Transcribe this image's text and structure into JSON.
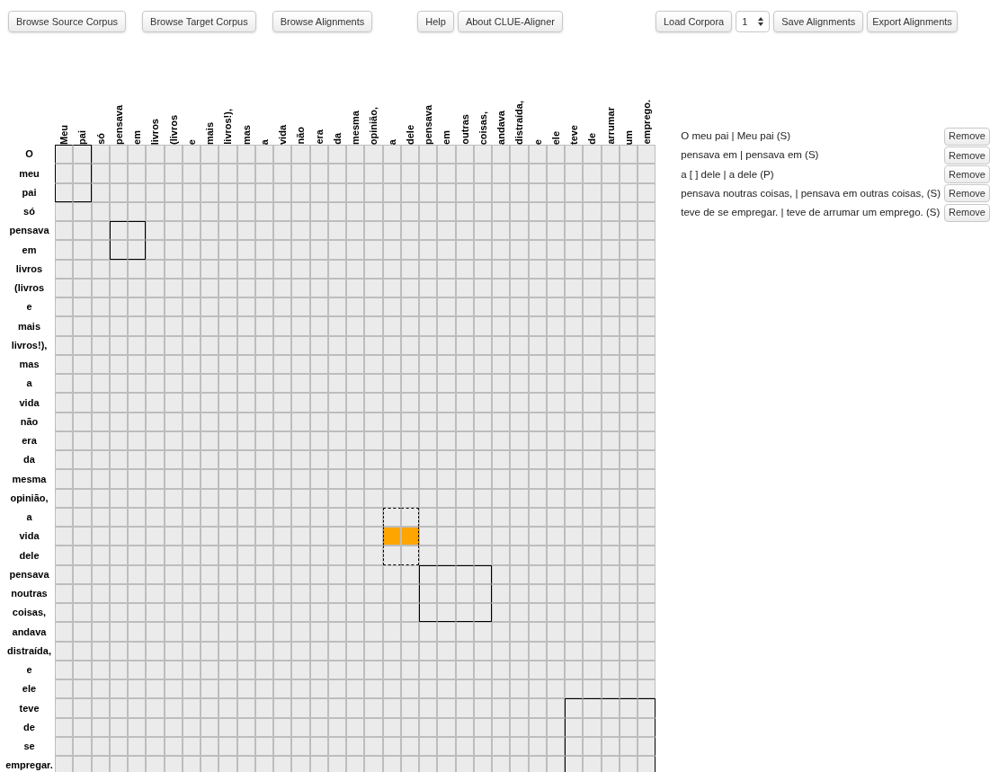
{
  "toolbar": {
    "left_buttons": [
      "Browse Source Corpus",
      "Browse Target Corpus",
      "Browse Alignments"
    ],
    "help_buttons": [
      "Help",
      "About CLUE-Aligner"
    ],
    "load_button": "Load Corpora",
    "corpus_select": {
      "value": "1"
    },
    "right_buttons": [
      "Save Alignments",
      "Export Alignments"
    ]
  },
  "matrix": {
    "target_words": [
      {
        "text": "Meu",
        "aligned": true,
        "block_start": true,
        "selected": false
      },
      {
        "text": "pai",
        "aligned": true,
        "block_start": false,
        "selected": false
      },
      {
        "text": "só",
        "aligned": false,
        "selected": false
      },
      {
        "text": "pensava",
        "aligned": true,
        "block_start": true,
        "selected": false
      },
      {
        "text": "em",
        "aligned": true,
        "block_start": false,
        "selected": false
      },
      {
        "text": "livros",
        "aligned": false,
        "selected": false
      },
      {
        "text": "(livros",
        "aligned": false,
        "selected": false
      },
      {
        "text": "e",
        "aligned": false,
        "selected": false
      },
      {
        "text": "mais",
        "aligned": false,
        "selected": false
      },
      {
        "text": "livros!),",
        "aligned": false,
        "selected": false
      },
      {
        "text": "mas",
        "aligned": false,
        "selected": false
      },
      {
        "text": "a",
        "aligned": false,
        "selected": false
      },
      {
        "text": "vida",
        "aligned": false,
        "selected": false
      },
      {
        "text": "não",
        "aligned": false,
        "selected": false
      },
      {
        "text": "era",
        "aligned": false,
        "selected": false
      },
      {
        "text": "da",
        "aligned": false,
        "selected": false
      },
      {
        "text": "mesma",
        "aligned": false,
        "selected": false
      },
      {
        "text": "opinião,",
        "aligned": false,
        "selected": false
      },
      {
        "text": "a",
        "aligned": true,
        "block_start": true,
        "selected": true
      },
      {
        "text": "dele",
        "aligned": true,
        "block_start": false,
        "selected": true
      },
      {
        "text": "pensava",
        "aligned": true,
        "block_start": true,
        "selected": false
      },
      {
        "text": "em",
        "aligned": true,
        "block_start": false,
        "selected": false
      },
      {
        "text": "outras",
        "aligned": true,
        "block_start": false,
        "selected": false
      },
      {
        "text": "coisas,",
        "aligned": true,
        "block_start": false,
        "selected": false
      },
      {
        "text": "andava",
        "aligned": false,
        "selected": false
      },
      {
        "text": "distraída,",
        "aligned": false,
        "selected": false
      },
      {
        "text": "e",
        "aligned": false,
        "selected": false
      },
      {
        "text": "ele",
        "aligned": false,
        "selected": false
      },
      {
        "text": "teve",
        "aligned": true,
        "block_start": true,
        "selected": false
      },
      {
        "text": "de",
        "aligned": true,
        "block_start": false,
        "selected": false
      },
      {
        "text": "arrumar",
        "aligned": true,
        "block_start": false,
        "selected": false
      },
      {
        "text": "um",
        "aligned": true,
        "block_start": false,
        "selected": false
      },
      {
        "text": "emprego.",
        "aligned": true,
        "block_start": false,
        "selected": false
      }
    ],
    "source_words": [
      {
        "text": "O",
        "aligned": true,
        "block_start": true,
        "selected": false
      },
      {
        "text": "meu",
        "aligned": true,
        "block_start": false,
        "selected": false
      },
      {
        "text": "pai",
        "aligned": true,
        "block_start": false,
        "selected": false
      },
      {
        "text": "só",
        "aligned": false,
        "selected": false
      },
      {
        "text": "pensava",
        "aligned": true,
        "block_start": true,
        "selected": false
      },
      {
        "text": "em",
        "aligned": true,
        "block_start": false,
        "selected": false
      },
      {
        "text": "livros",
        "aligned": false,
        "selected": false
      },
      {
        "text": "(livros",
        "aligned": false,
        "selected": false
      },
      {
        "text": "e",
        "aligned": false,
        "selected": false
      },
      {
        "text": "mais",
        "aligned": false,
        "selected": false
      },
      {
        "text": "livros!),",
        "aligned": false,
        "selected": false
      },
      {
        "text": "mas",
        "aligned": false,
        "selected": false
      },
      {
        "text": "a",
        "aligned": false,
        "selected": false
      },
      {
        "text": "vida",
        "aligned": false,
        "selected": false
      },
      {
        "text": "não",
        "aligned": false,
        "selected": false
      },
      {
        "text": "era",
        "aligned": false,
        "selected": false
      },
      {
        "text": "da",
        "aligned": false,
        "selected": false
      },
      {
        "text": "mesma",
        "aligned": false,
        "selected": false
      },
      {
        "text": "opinião,",
        "aligned": false,
        "selected": false
      },
      {
        "text": "a",
        "aligned": true,
        "block_start": true,
        "selected": false
      },
      {
        "text": "vida",
        "aligned": true,
        "block_start": false,
        "selected": true
      },
      {
        "text": "dele",
        "aligned": true,
        "block_start": false,
        "selected": false
      },
      {
        "text": "pensava",
        "aligned": true,
        "block_start": true,
        "selected": false
      },
      {
        "text": "noutras",
        "aligned": true,
        "block_start": false,
        "selected": false
      },
      {
        "text": "coisas,",
        "aligned": true,
        "block_start": false,
        "selected": false
      },
      {
        "text": "andava",
        "aligned": false,
        "selected": false
      },
      {
        "text": "distraída,",
        "aligned": false,
        "selected": false
      },
      {
        "text": "e",
        "aligned": false,
        "selected": false
      },
      {
        "text": "ele",
        "aligned": false,
        "selected": false
      },
      {
        "text": "teve",
        "aligned": true,
        "block_start": true,
        "selected": false
      },
      {
        "text": "de",
        "aligned": true,
        "block_start": false,
        "selected": false
      },
      {
        "text": "se",
        "aligned": true,
        "block_start": false,
        "selected": false
      },
      {
        "text": "empregar.",
        "aligned": true,
        "block_start": false,
        "selected": false
      }
    ]
  },
  "alignments": [
    {
      "text": "O meu pai | Meu pai (S)",
      "kind": "sure",
      "button": "Remove"
    },
    {
      "text": "pensava em | pensava em (S)",
      "kind": "sure",
      "button": "Remove"
    },
    {
      "text": "a [ ] dele | a dele (P)",
      "kind": "possible",
      "button": "Remove"
    },
    {
      "text": "pensava noutras coisas, | pensava em outras coisas, (S)",
      "kind": "sure",
      "button": "Remove"
    },
    {
      "text": "teve de se empregar. | teve de arrumar um emprego. (S)",
      "kind": "sure",
      "button": "Remove"
    }
  ]
}
